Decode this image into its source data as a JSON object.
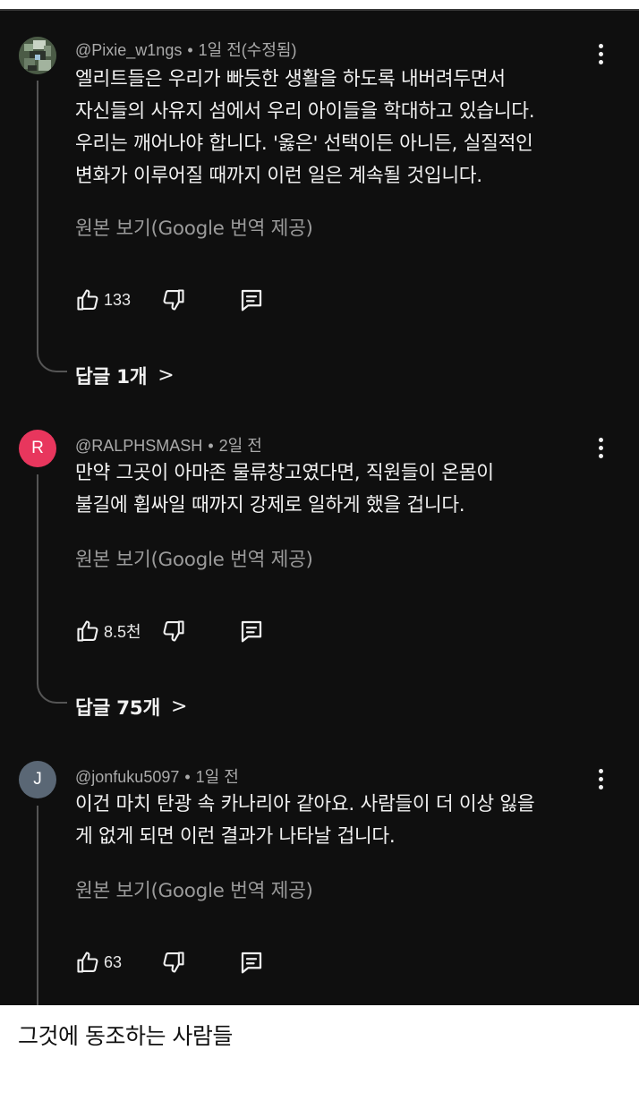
{
  "comments": [
    {
      "avatar_icon": "pixel-art-avatar",
      "author": "@Pixie_w1ngs",
      "separator": "•",
      "time": "1일 전(수정됨)",
      "lines": [
        "엘리트들은 우리가 빠듯한 생활을 하도록 내버려두면서",
        "자신들의 사유지 섬에서 우리 아이들을 학대하고 있습니다.",
        "우리는 깨어나야 합니다. '옳은' 선택이든 아니든, 실질적인",
        "변화가 이루어질 때까지 이런 일은 계속될 것입니다."
      ],
      "translate_label": "원본 보기(Google 번역 제공)",
      "likes": "133",
      "replies_label": "답글 1개",
      "replies_chevron": ">"
    },
    {
      "avatar_letter": "R",
      "avatar_color": "#e8365d",
      "author": "@RALPHSMASH",
      "separator": "•",
      "time": "2일 전",
      "lines": [
        "만약 그곳이 아마존 물류창고였다면, 직원들이 온몸이",
        "불길에 휩싸일 때까지 강제로 일하게 했을 겁니다."
      ],
      "translate_label": "원본 보기(Google 번역 제공)",
      "likes": "8.5천",
      "replies_label": "답글 75개",
      "replies_chevron": ">"
    },
    {
      "avatar_letter": "J",
      "avatar_color": "#5a6775",
      "author": "@jonfuku5097",
      "separator": "•",
      "time": "1일 전",
      "lines": [
        "이건 마치 탄광 속 카나리아 같아요. 사람들이 더 이상 잃을",
        "게 없게 되면 이런 결과가 나타날 겁니다."
      ],
      "translate_label": "원본 보기(Google 번역 제공)",
      "likes": "63"
    }
  ],
  "icons": {
    "like": "thumbs-up-icon",
    "dislike": "thumbs-down-icon",
    "reply": "comment-icon",
    "more": "more-vertical-icon"
  },
  "caption": "그것에 동조하는 사람들"
}
